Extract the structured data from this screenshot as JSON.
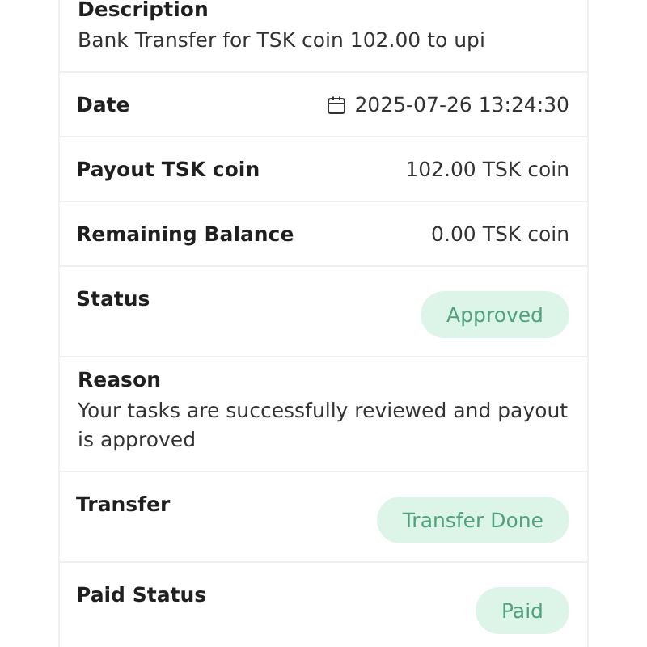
{
  "details": [
    {
      "kind": "stacked",
      "label": "Description",
      "value": "Bank Transfer for TSK coin 102.00 to upi"
    },
    {
      "kind": "date",
      "label": "Date",
      "value": "2025-07-26 13:24:30"
    },
    {
      "kind": "inline",
      "label": "Payout TSK coin",
      "value": "102.00 TSK coin"
    },
    {
      "kind": "inline",
      "label": "Remaining Balance",
      "value": "0.00 TSK coin"
    },
    {
      "kind": "badge",
      "label": "Status",
      "value": "Approved"
    },
    {
      "kind": "stacked",
      "label": "Reason",
      "value": "Your tasks are successfully reviewed and payout is approved"
    },
    {
      "kind": "badge",
      "label": "Transfer",
      "value": "Transfer Done"
    },
    {
      "kind": "badge",
      "label": "Paid Status",
      "value": "Paid"
    }
  ]
}
